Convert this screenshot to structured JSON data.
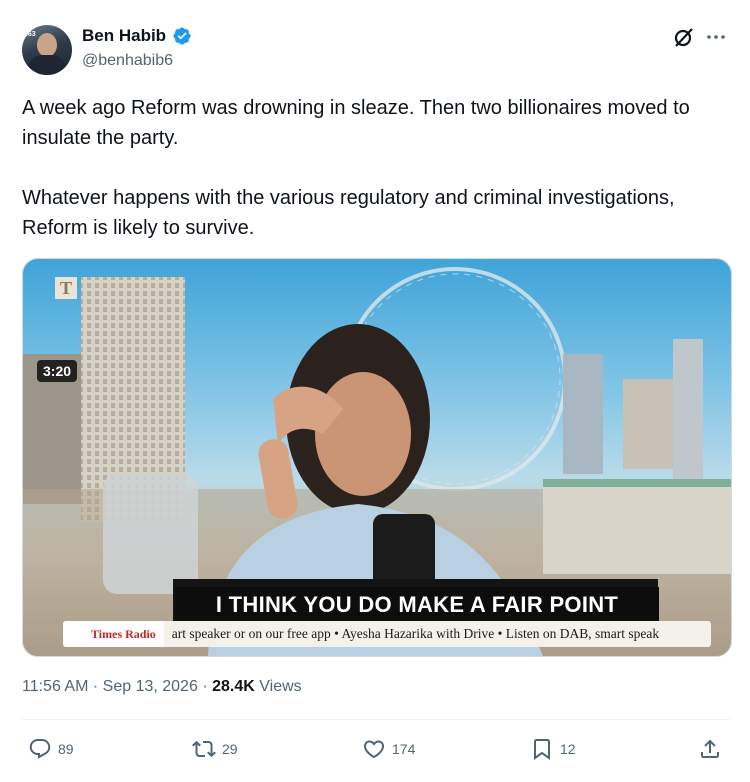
{
  "author": {
    "name": "Ben Habib",
    "handle": "@benhabib6",
    "avatar_tag": "863"
  },
  "tweet": {
    "text": "A week ago Reform was drowning in sleaze. Then two billionaires moved to insulate the party.\n\nWhatever happens with the various regulatory and criminal investigations, Reform is likely to survive."
  },
  "media": {
    "subtitle": "I THINK YOU DO MAKE A FAIR POINT",
    "duration": "3:20",
    "logo": "T",
    "ticker_brand": "Times Radio",
    "ticker_text": "art speaker or on our free app  •  Ayesha Hazarika with Drive  •  Listen on DAB, smart speak"
  },
  "meta": {
    "time": "11:56 AM",
    "separator": "·",
    "date": "Sep 13, 2026",
    "views_count": "28.4K",
    "views_label": "Views"
  },
  "actions": {
    "replies": "89",
    "reposts": "29",
    "likes": "174",
    "bookmarks": "12"
  },
  "colors": {
    "verified": "#1d9bf0",
    "text_secondary": "#536471",
    "text_primary": "#0f1419"
  },
  "icons": [
    "verified-badge-icon",
    "grok-icon",
    "more-icon",
    "reply-icon",
    "repost-icon",
    "like-icon",
    "bookmark-icon",
    "share-icon"
  ]
}
